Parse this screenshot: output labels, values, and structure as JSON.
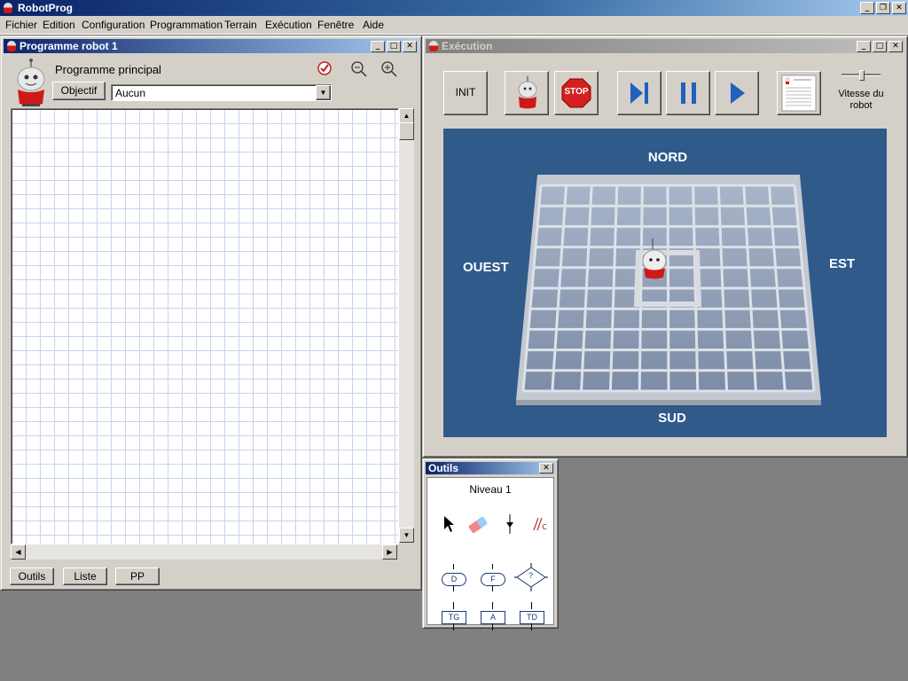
{
  "app": {
    "title": "RobotProg"
  },
  "menu": [
    "Fichier",
    "Edition",
    "Configuration",
    "Programmation",
    "Terrain",
    "Exécution",
    "Fenêtre",
    "Aide"
  ],
  "program_window": {
    "title": "Programme robot 1",
    "program_label": "Programme principal",
    "objectif_button": "Objectif",
    "objectif_value": "Aucun",
    "bottom_buttons": [
      "Outils",
      "Liste",
      "PP"
    ]
  },
  "exec_window": {
    "title": "Exécution",
    "init_label": "INIT",
    "stop_label": "STOP",
    "speed_label": "Vitesse du robot",
    "directions": {
      "north": "NORD",
      "south": "SUD",
      "west": "OUEST",
      "east": "EST"
    }
  },
  "tools_window": {
    "title": "Outils",
    "level": "Niveau 1",
    "shapes": [
      "D",
      "F",
      "?"
    ],
    "actions": [
      "TG",
      "A",
      "TD"
    ]
  },
  "colors": {
    "arena_bg": "#2f5a8a",
    "title_active": "#0a246a",
    "stop_red": "#d42020"
  }
}
